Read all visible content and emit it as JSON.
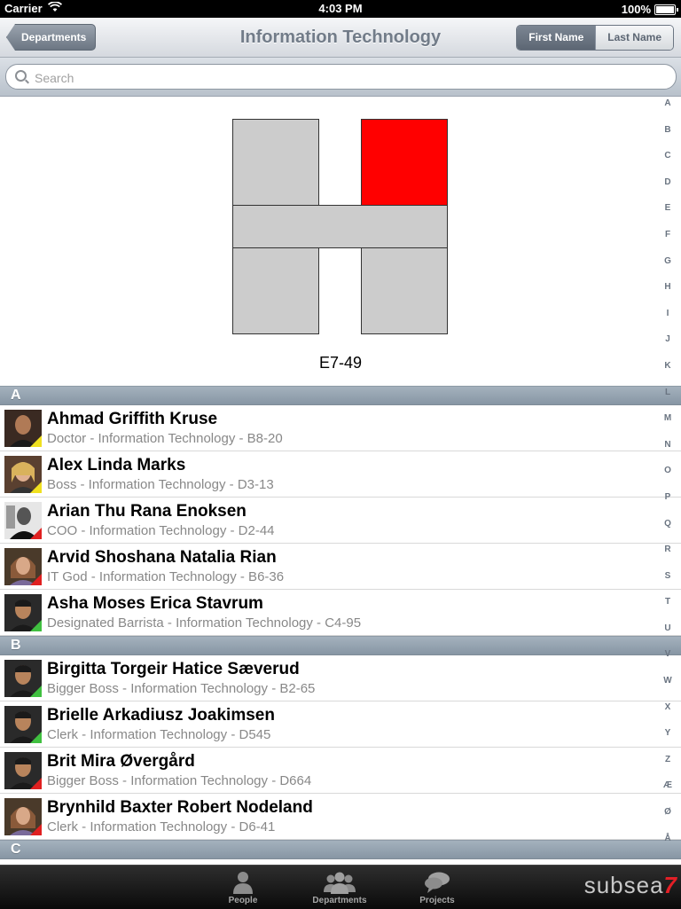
{
  "status_bar": {
    "carrier": "Carrier",
    "time": "4:03 PM",
    "battery": "100%"
  },
  "nav": {
    "back_label": "Departments",
    "title": "Information Technology",
    "segments": [
      {
        "label": "First Name",
        "selected": true
      },
      {
        "label": "Last Name",
        "selected": false
      }
    ]
  },
  "search": {
    "placeholder": "Search",
    "value": ""
  },
  "floor_map": {
    "room_code": "E7-49",
    "highlight_color": "#ff0000"
  },
  "sections": [
    {
      "letter": "A",
      "people": [
        {
          "name": "Ahmad Griffith Kruse",
          "subtitle": "Doctor - Information Technology - B8-20",
          "status_color": "#f0e020"
        },
        {
          "name": "Alex Linda Marks",
          "subtitle": "Boss - Information Technology - D3-13",
          "status_color": "#f0e020"
        },
        {
          "name": "Arian Thu Rana Enoksen",
          "subtitle": "COO - Information Technology - D2-44",
          "status_color": "#e02020"
        },
        {
          "name": "Arvid Shoshana Natalia Rian",
          "subtitle": "IT God - Information Technology - B6-36",
          "status_color": "#e02020"
        },
        {
          "name": "Asha Moses Erica Stavrum",
          "subtitle": "Designated Barrista - Information Technology - C4-95",
          "status_color": "#40c040"
        }
      ]
    },
    {
      "letter": "B",
      "people": [
        {
          "name": "Birgitta Torgeir Hatice Sæverud",
          "subtitle": "Bigger Boss - Information Technology - B2-65",
          "status_color": "#40c040"
        },
        {
          "name": "Brielle Arkadiusz Joakimsen",
          "subtitle": "Clerk - Information Technology - D545",
          "status_color": "#40c040"
        },
        {
          "name": "Brit Mira Øvergård",
          "subtitle": "Bigger Boss - Information Technology - D664",
          "status_color": "#e02020"
        },
        {
          "name": "Brynhild Baxter Robert Nodeland",
          "subtitle": "Clerk - Information Technology - D6-41",
          "status_color": "#e02020"
        }
      ]
    },
    {
      "letter": "C",
      "people": []
    }
  ],
  "index_letters": [
    "A",
    "B",
    "C",
    "D",
    "E",
    "F",
    "G",
    "H",
    "I",
    "J",
    "K",
    "L",
    "M",
    "N",
    "O",
    "P",
    "Q",
    "R",
    "S",
    "T",
    "U",
    "V",
    "W",
    "X",
    "Y",
    "Z",
    "Æ",
    "Ø",
    "Å"
  ],
  "tabs": [
    {
      "label": "People",
      "icon": "person-icon"
    },
    {
      "label": "Departments",
      "icon": "group-icon"
    },
    {
      "label": "Projects",
      "icon": "chat-bubbles-icon"
    }
  ],
  "brand": {
    "text": "subsea",
    "mark": "7"
  }
}
